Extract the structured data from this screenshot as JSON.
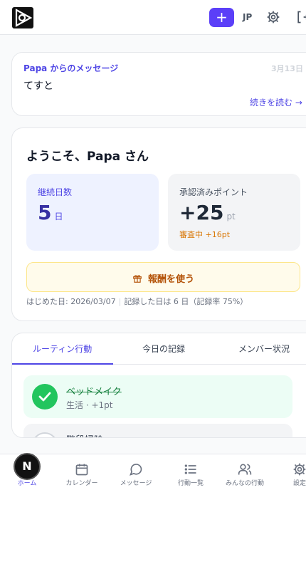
{
  "header": {
    "add_label": "+",
    "language": "JP"
  },
  "message": {
    "from": "Papa からのメッセージ",
    "date": "3月13日",
    "text": "てすと",
    "more": "続きを読む →"
  },
  "welcome": {
    "title": "ようこそ、Papa さん",
    "streak": {
      "label": "継続日数",
      "value": "5",
      "unit": "日"
    },
    "points": {
      "label": "承認済みポイント",
      "value": "+25",
      "unit": "pt",
      "pending": "審査中 +16pt"
    },
    "reward_label": "報酬を使う",
    "started": "はじめた日: 2026/03/07",
    "separator": "|",
    "recorded": "記録した日は 6 日（記録率 75%）"
  },
  "tabs": [
    "ルーティン行動",
    "今日の記録",
    "メンバー状況"
  ],
  "routines": [
    {
      "name": "ベッドメイク",
      "meta": "生活 · +1pt",
      "done": true
    },
    {
      "name": "階段掃除",
      "meta": "",
      "done": false
    }
  ],
  "nav": [
    {
      "label": "ホーム",
      "icon": "home-icon"
    },
    {
      "label": "カレンダー",
      "icon": "calendar-icon"
    },
    {
      "label": "メッセージ",
      "icon": "message-icon"
    },
    {
      "label": "行動一覧",
      "icon": "list-icon"
    },
    {
      "label": "みんなの行動",
      "icon": "users-icon"
    },
    {
      "label": "設定",
      "icon": "gear-icon"
    }
  ],
  "badge": "N",
  "colors": {
    "accent": "#4f46e5",
    "button": "#5b3ff8",
    "success": "#22c55e",
    "warning": "#d97706"
  }
}
